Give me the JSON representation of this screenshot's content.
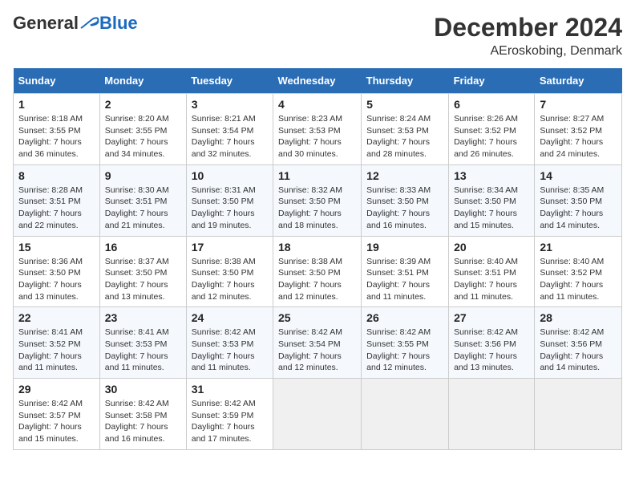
{
  "logo": {
    "general": "General",
    "blue": "Blue"
  },
  "header": {
    "month": "December 2024",
    "location": "AEroskobing, Denmark"
  },
  "weekdays": [
    "Sunday",
    "Monday",
    "Tuesday",
    "Wednesday",
    "Thursday",
    "Friday",
    "Saturday"
  ],
  "weeks": [
    [
      {
        "day": "1",
        "sunrise": "8:18 AM",
        "sunset": "3:55 PM",
        "daylight": "7 hours and 36 minutes."
      },
      {
        "day": "2",
        "sunrise": "8:20 AM",
        "sunset": "3:55 PM",
        "daylight": "7 hours and 34 minutes."
      },
      {
        "day": "3",
        "sunrise": "8:21 AM",
        "sunset": "3:54 PM",
        "daylight": "7 hours and 32 minutes."
      },
      {
        "day": "4",
        "sunrise": "8:23 AM",
        "sunset": "3:53 PM",
        "daylight": "7 hours and 30 minutes."
      },
      {
        "day": "5",
        "sunrise": "8:24 AM",
        "sunset": "3:53 PM",
        "daylight": "7 hours and 28 minutes."
      },
      {
        "day": "6",
        "sunrise": "8:26 AM",
        "sunset": "3:52 PM",
        "daylight": "7 hours and 26 minutes."
      },
      {
        "day": "7",
        "sunrise": "8:27 AM",
        "sunset": "3:52 PM",
        "daylight": "7 hours and 24 minutes."
      }
    ],
    [
      {
        "day": "8",
        "sunrise": "8:28 AM",
        "sunset": "3:51 PM",
        "daylight": "7 hours and 22 minutes."
      },
      {
        "day": "9",
        "sunrise": "8:30 AM",
        "sunset": "3:51 PM",
        "daylight": "7 hours and 21 minutes."
      },
      {
        "day": "10",
        "sunrise": "8:31 AM",
        "sunset": "3:50 PM",
        "daylight": "7 hours and 19 minutes."
      },
      {
        "day": "11",
        "sunrise": "8:32 AM",
        "sunset": "3:50 PM",
        "daylight": "7 hours and 18 minutes."
      },
      {
        "day": "12",
        "sunrise": "8:33 AM",
        "sunset": "3:50 PM",
        "daylight": "7 hours and 16 minutes."
      },
      {
        "day": "13",
        "sunrise": "8:34 AM",
        "sunset": "3:50 PM",
        "daylight": "7 hours and 15 minutes."
      },
      {
        "day": "14",
        "sunrise": "8:35 AM",
        "sunset": "3:50 PM",
        "daylight": "7 hours and 14 minutes."
      }
    ],
    [
      {
        "day": "15",
        "sunrise": "8:36 AM",
        "sunset": "3:50 PM",
        "daylight": "7 hours and 13 minutes."
      },
      {
        "day": "16",
        "sunrise": "8:37 AM",
        "sunset": "3:50 PM",
        "daylight": "7 hours and 13 minutes."
      },
      {
        "day": "17",
        "sunrise": "8:38 AM",
        "sunset": "3:50 PM",
        "daylight": "7 hours and 12 minutes."
      },
      {
        "day": "18",
        "sunrise": "8:38 AM",
        "sunset": "3:50 PM",
        "daylight": "7 hours and 12 minutes."
      },
      {
        "day": "19",
        "sunrise": "8:39 AM",
        "sunset": "3:51 PM",
        "daylight": "7 hours and 11 minutes."
      },
      {
        "day": "20",
        "sunrise": "8:40 AM",
        "sunset": "3:51 PM",
        "daylight": "7 hours and 11 minutes."
      },
      {
        "day": "21",
        "sunrise": "8:40 AM",
        "sunset": "3:52 PM",
        "daylight": "7 hours and 11 minutes."
      }
    ],
    [
      {
        "day": "22",
        "sunrise": "8:41 AM",
        "sunset": "3:52 PM",
        "daylight": "7 hours and 11 minutes."
      },
      {
        "day": "23",
        "sunrise": "8:41 AM",
        "sunset": "3:53 PM",
        "daylight": "7 hours and 11 minutes."
      },
      {
        "day": "24",
        "sunrise": "8:42 AM",
        "sunset": "3:53 PM",
        "daylight": "7 hours and 11 minutes."
      },
      {
        "day": "25",
        "sunrise": "8:42 AM",
        "sunset": "3:54 PM",
        "daylight": "7 hours and 12 minutes."
      },
      {
        "day": "26",
        "sunrise": "8:42 AM",
        "sunset": "3:55 PM",
        "daylight": "7 hours and 12 minutes."
      },
      {
        "day": "27",
        "sunrise": "8:42 AM",
        "sunset": "3:56 PM",
        "daylight": "7 hours and 13 minutes."
      },
      {
        "day": "28",
        "sunrise": "8:42 AM",
        "sunset": "3:56 PM",
        "daylight": "7 hours and 14 minutes."
      }
    ],
    [
      {
        "day": "29",
        "sunrise": "8:42 AM",
        "sunset": "3:57 PM",
        "daylight": "7 hours and 15 minutes."
      },
      {
        "day": "30",
        "sunrise": "8:42 AM",
        "sunset": "3:58 PM",
        "daylight": "7 hours and 16 minutes."
      },
      {
        "day": "31",
        "sunrise": "8:42 AM",
        "sunset": "3:59 PM",
        "daylight": "7 hours and 17 minutes."
      },
      null,
      null,
      null,
      null
    ]
  ],
  "labels": {
    "sunrise": "Sunrise:",
    "sunset": "Sunset:",
    "daylight": "Daylight:"
  }
}
